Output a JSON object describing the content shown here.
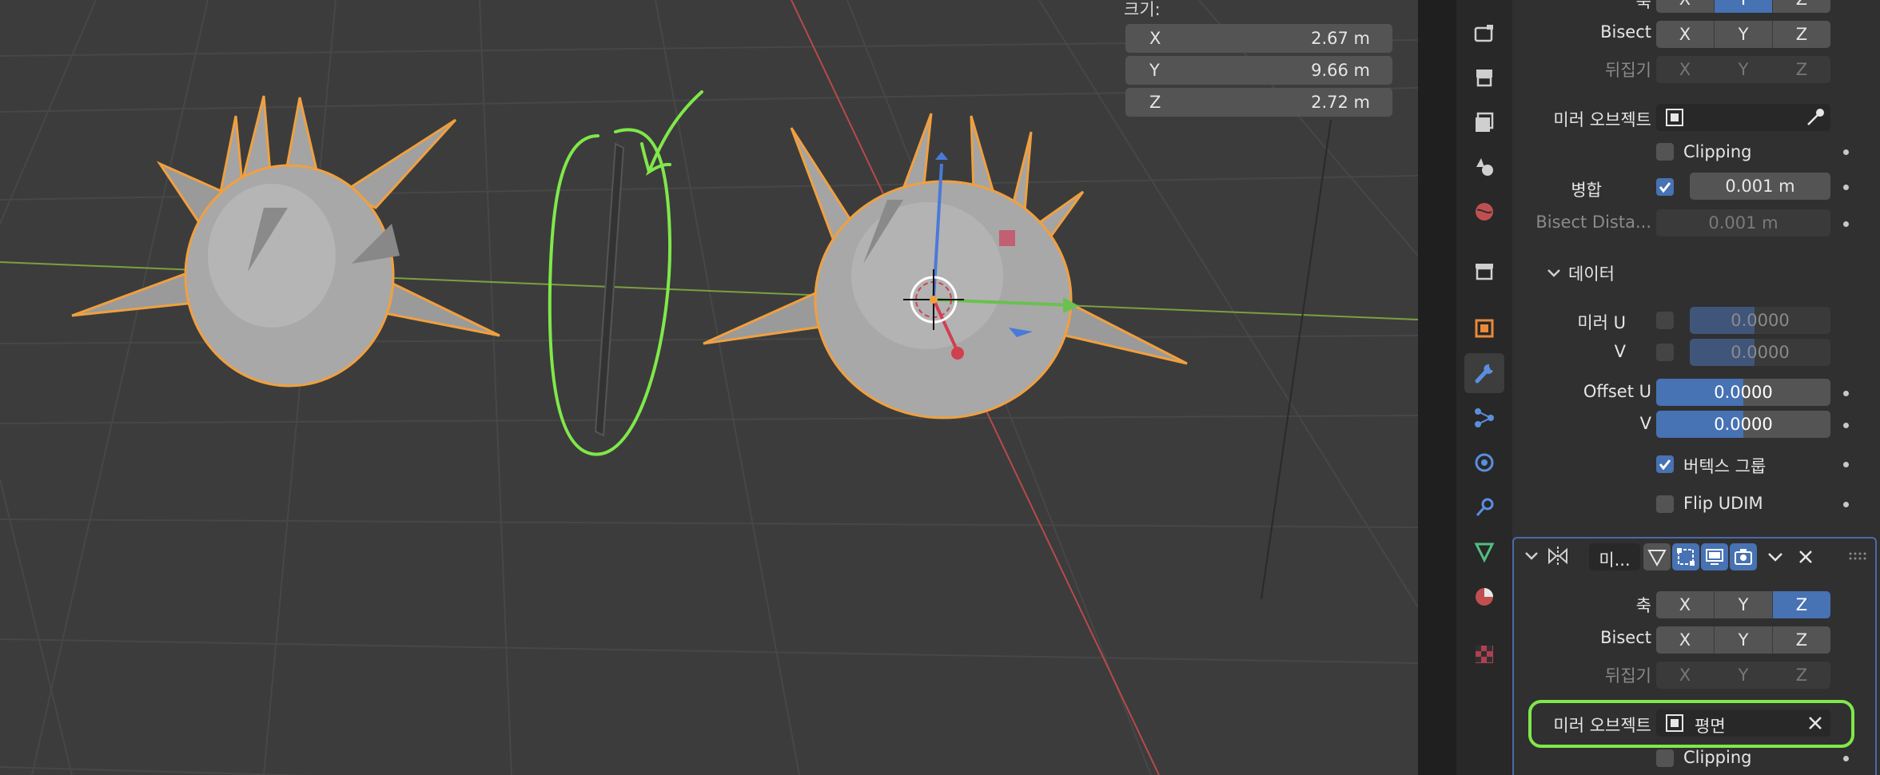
{
  "viewport": {
    "size_panel": {
      "title": "크기:",
      "rows": [
        {
          "axis": "X",
          "value": "2.67 m"
        },
        {
          "axis": "Y",
          "value": "9.66 m"
        },
        {
          "axis": "Z",
          "value": "2.72 m"
        }
      ]
    }
  },
  "properties": {
    "mirror1": {
      "axis_label": "축",
      "axis_buttons": [
        "X",
        "Y",
        "Z"
      ],
      "bisect_label": "Bisect",
      "bisect_buttons": [
        "X",
        "Y",
        "Z"
      ],
      "flip_label": "뒤집기",
      "flip_buttons": [
        "X",
        "Y",
        "Z"
      ],
      "mirror_object_label": "미러 오브젝트",
      "clipping_label": "Clipping",
      "merge_label": "병합",
      "merge_value": "0.001 m",
      "bisect_distance_label": "Bisect Dista...",
      "bisect_distance_value": "0.001 m",
      "data_section_label": "데이터",
      "mirror_u_label": "미러 U",
      "mirror_u_value": "0.0000",
      "mirror_v_label": "V",
      "mirror_v_value": "0.0000",
      "offset_u_label": "Offset U",
      "offset_u_value": "0.0000",
      "offset_v_label": "V",
      "offset_v_value": "0.0000",
      "vertex_group_label": "버텍스 그룹",
      "flip_udim_label": "Flip UDIM"
    },
    "mirror2": {
      "name": "미...",
      "axis_label": "축",
      "axis_buttons": [
        "X",
        "Y",
        "Z"
      ],
      "bisect_label": "Bisect",
      "bisect_buttons": [
        "X",
        "Y",
        "Z"
      ],
      "flip_label": "뒤집기",
      "flip_buttons": [
        "X",
        "Y",
        "Z"
      ],
      "mirror_object_label": "미러 오브젝트",
      "mirror_object_value": "평면",
      "clipping_label": "Clipping"
    }
  },
  "colors": {
    "accent": "#4772b3",
    "selection_outline": "#f0a040",
    "annotation": "#7fe84a"
  }
}
